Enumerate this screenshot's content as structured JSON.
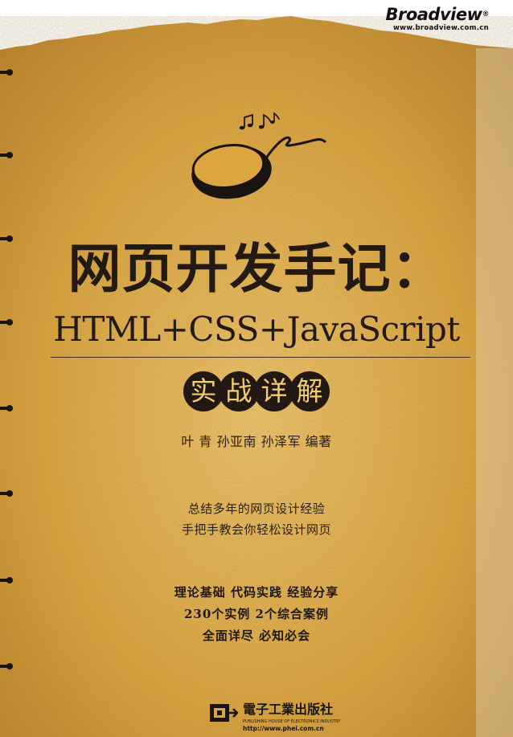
{
  "brand": {
    "name": "Broadview",
    "url": "www.broadview.com.cn"
  },
  "title": {
    "main": "网页开发手记：",
    "subtitle": "HTML+CSS+JavaScript"
  },
  "badge_chars": [
    "实",
    "战",
    "详",
    "解"
  ],
  "authors": "叶 青  孙亚南  孙泽军  编著",
  "taglines": [
    "总结多年的网页设计经验",
    "手把手教会你轻松设计网页"
  ],
  "bullets": [
    "理论基础  代码实践  经验分享",
    "230个实例  2个综合案例",
    "全面详尽  必知必会"
  ],
  "publisher": {
    "name": "電子工業出版社",
    "name_en": "PUBLISHING HOUSE OF ELECTRONICS INDUSTRY",
    "url": "http://www.phei.com.cn"
  },
  "colors": {
    "paper": "#dca53f",
    "paper_light": "#efc66f",
    "ink": "#231a14",
    "badge_text": "#f1cd6e"
  }
}
